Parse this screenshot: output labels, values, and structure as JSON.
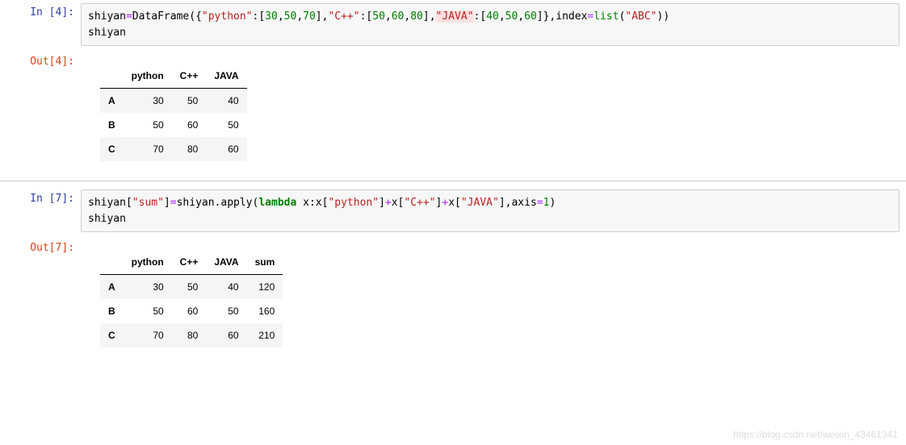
{
  "cells": [
    {
      "in_prompt": "In  [4]:",
      "out_prompt": "Out[4]:",
      "code_tokens_line1": [
        {
          "text": "shiyan",
          "cls": "tok-name"
        },
        {
          "text": "=",
          "cls": "tok-op"
        },
        {
          "text": "DataFrame({",
          "cls": "tok-name"
        },
        {
          "text": "\"python\"",
          "cls": "tok-str"
        },
        {
          "text": ":[",
          "cls": "tok-name"
        },
        {
          "text": "30",
          "cls": "tok-num"
        },
        {
          "text": ",",
          "cls": "tok-name"
        },
        {
          "text": "50",
          "cls": "tok-num"
        },
        {
          "text": ",",
          "cls": "tok-name"
        },
        {
          "text": "70",
          "cls": "tok-num"
        },
        {
          "text": "],",
          "cls": "tok-name"
        },
        {
          "text": "\"C++\"",
          "cls": "tok-str"
        },
        {
          "text": ":[",
          "cls": "tok-name"
        },
        {
          "text": "50",
          "cls": "tok-num"
        },
        {
          "text": ",",
          "cls": "tok-name"
        },
        {
          "text": "60",
          "cls": "tok-num"
        },
        {
          "text": ",",
          "cls": "tok-name"
        },
        {
          "text": "80",
          "cls": "tok-num"
        },
        {
          "text": "],",
          "cls": "tok-name"
        },
        {
          "text": "\"JAVA\"",
          "cls": "tok-str tok-highlight"
        },
        {
          "text": ":[",
          "cls": "tok-name"
        },
        {
          "text": "40",
          "cls": "tok-num"
        },
        {
          "text": ",",
          "cls": "tok-name"
        },
        {
          "text": "50",
          "cls": "tok-num"
        },
        {
          "text": ",",
          "cls": "tok-name"
        },
        {
          "text": "60",
          "cls": "tok-num"
        },
        {
          "text": "]},index",
          "cls": "tok-name"
        },
        {
          "text": "=",
          "cls": "tok-op"
        },
        {
          "text": "list",
          "cls": "tok-builtin"
        },
        {
          "text": "(",
          "cls": "tok-name"
        },
        {
          "text": "\"ABC\"",
          "cls": "tok-str"
        },
        {
          "text": "))",
          "cls": "tok-name"
        }
      ],
      "code_line2": "shiyan",
      "table": {
        "columns": [
          "",
          "python",
          "C++",
          "JAVA"
        ],
        "rows": [
          {
            "idx": "A",
            "vals": [
              "30",
              "50",
              "40"
            ]
          },
          {
            "idx": "B",
            "vals": [
              "50",
              "60",
              "50"
            ]
          },
          {
            "idx": "C",
            "vals": [
              "70",
              "80",
              "60"
            ]
          }
        ]
      }
    },
    {
      "in_prompt": "In  [7]:",
      "out_prompt": "Out[7]:",
      "code_tokens_line1": [
        {
          "text": "shiyan[",
          "cls": "tok-name"
        },
        {
          "text": "\"sum\"",
          "cls": "tok-str"
        },
        {
          "text": "]",
          "cls": "tok-name"
        },
        {
          "text": "=",
          "cls": "tok-op"
        },
        {
          "text": "shiyan.apply(",
          "cls": "tok-name"
        },
        {
          "text": "lambda",
          "cls": "tok-kw"
        },
        {
          "text": " x:x[",
          "cls": "tok-name"
        },
        {
          "text": "\"python\"",
          "cls": "tok-str"
        },
        {
          "text": "]",
          "cls": "tok-name"
        },
        {
          "text": "+",
          "cls": "tok-op"
        },
        {
          "text": "x[",
          "cls": "tok-name"
        },
        {
          "text": "\"C++\"",
          "cls": "tok-str"
        },
        {
          "text": "]",
          "cls": "tok-name"
        },
        {
          "text": "+",
          "cls": "tok-op"
        },
        {
          "text": "x[",
          "cls": "tok-name"
        },
        {
          "text": "\"JAVA\"",
          "cls": "tok-str"
        },
        {
          "text": "],axis",
          "cls": "tok-name"
        },
        {
          "text": "=",
          "cls": "tok-op"
        },
        {
          "text": "1",
          "cls": "tok-num"
        },
        {
          "text": ")",
          "cls": "tok-name"
        }
      ],
      "code_line2": "shiyan",
      "table": {
        "columns": [
          "",
          "python",
          "C++",
          "JAVA",
          "sum"
        ],
        "rows": [
          {
            "idx": "A",
            "vals": [
              "30",
              "50",
              "40",
              "120"
            ]
          },
          {
            "idx": "B",
            "vals": [
              "50",
              "60",
              "50",
              "160"
            ]
          },
          {
            "idx": "C",
            "vals": [
              "70",
              "80",
              "60",
              "210"
            ]
          }
        ]
      }
    }
  ],
  "watermark": "https://blog.csdn.net/weixin_43461341"
}
